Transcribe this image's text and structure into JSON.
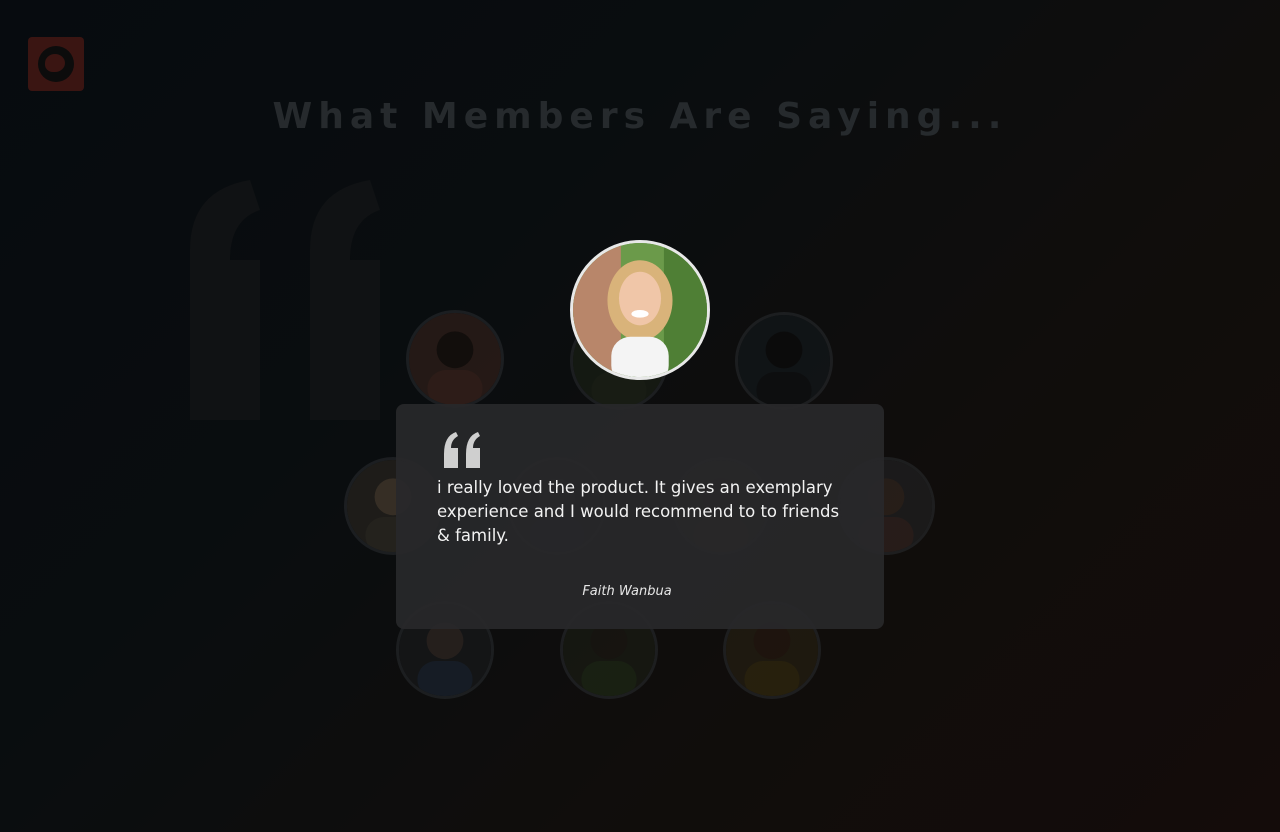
{
  "section": {
    "title": "What Members Are Saying..."
  },
  "logo": {
    "icon": "brand-logo-icon"
  },
  "testimonial": {
    "text": "i really loved the product. It gives an exemplary experience and I would recommend to to friends & family.",
    "author": "Faith Wanbua"
  },
  "colors": {
    "accent": "#3a1512",
    "card": "#28282a",
    "title": "#262a2d"
  }
}
